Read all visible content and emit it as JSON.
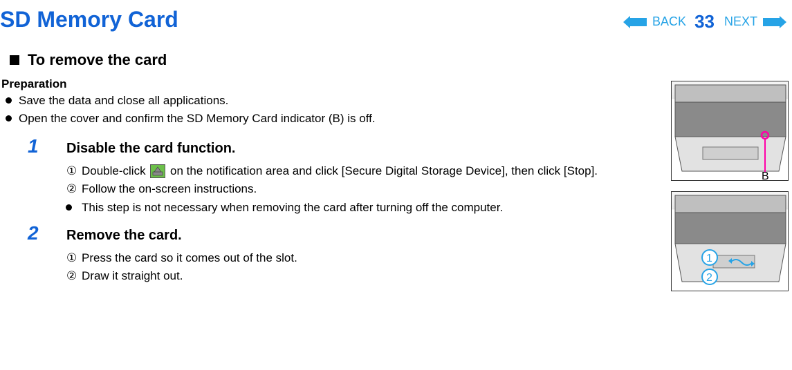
{
  "header": {
    "title": "SD Memory Card",
    "back_label": "BACK",
    "page_number": "33",
    "next_label": "NEXT"
  },
  "section_heading": "To remove the card",
  "preparation": {
    "title": "Preparation",
    "items": [
      "Save the data and close all applications.",
      "Open the cover and confirm the SD Memory Card indicator (B) is off."
    ]
  },
  "steps": [
    {
      "num": "1",
      "title": "Disable the card function.",
      "subs": [
        {
          "marker": "①",
          "pre": "Double-click ",
          "has_icon": true,
          "post": " on the notification area and click [Secure Digital Storage Device], then click [Stop]."
        },
        {
          "marker": "②",
          "text": "Follow the on-screen instructions."
        },
        {
          "marker": "bullet",
          "text": "This step is not necessary when removing the card after turning off the computer."
        }
      ]
    },
    {
      "num": "2",
      "title": "Remove the card.",
      "subs": [
        {
          "marker": "①",
          "text": "Press the card so it comes out of the slot."
        },
        {
          "marker": "②",
          "text": "Draw it straight out."
        }
      ]
    }
  ],
  "illustrations": {
    "label_b": "B",
    "label_1": "1",
    "label_2": "2"
  },
  "icons": {
    "safe_remove": "safe-remove-hardware-icon"
  }
}
